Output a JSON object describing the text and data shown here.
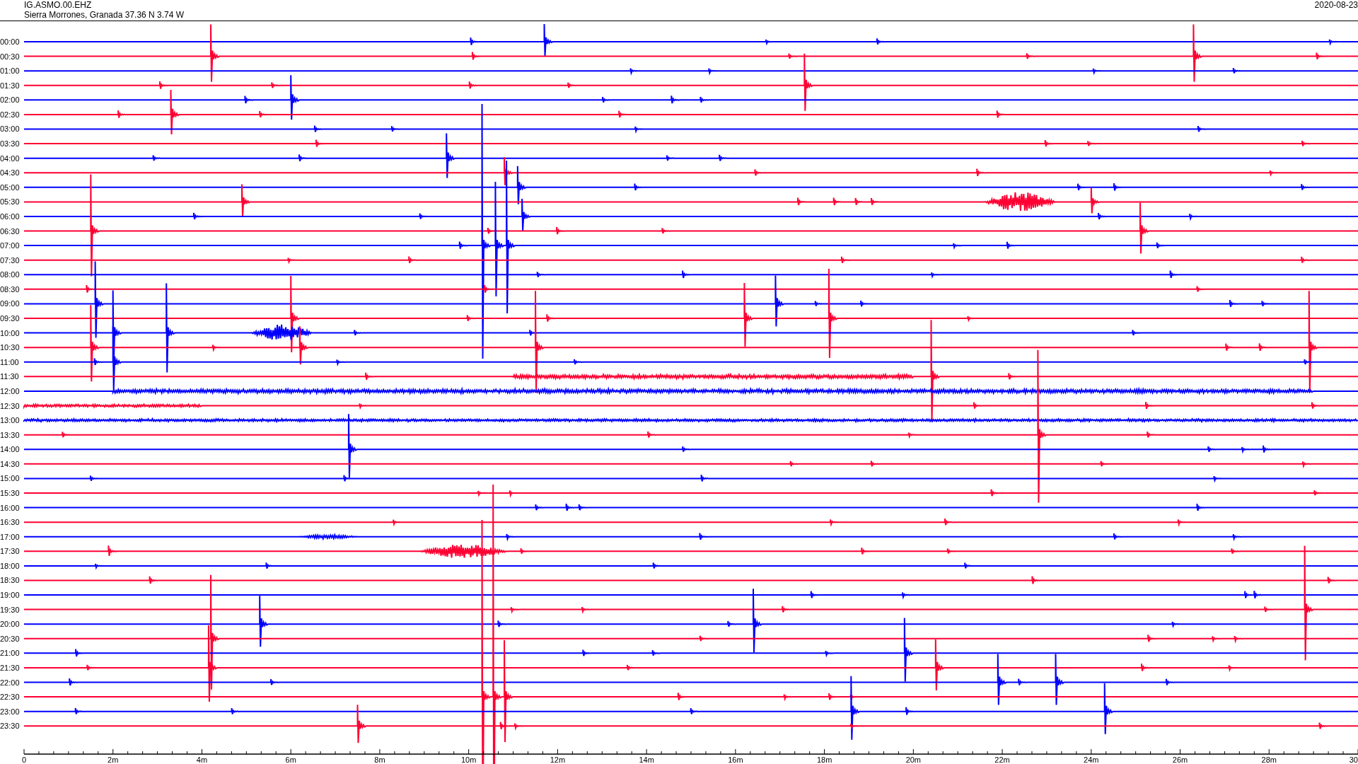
{
  "header": {
    "station": "IG.ASMO.00.EHZ",
    "location": "Sierra Morrones, Granada  37.36 N 3.74 W",
    "date": "2020-08-23"
  },
  "rows": [
    {
      "label": "00:00",
      "color": "#0000ff"
    },
    {
      "label": "00:30",
      "color": "#ff0033"
    },
    {
      "label": "01:00",
      "color": "#0000ff"
    },
    {
      "label": "01:30",
      "color": "#ff0033"
    },
    {
      "label": "02:00",
      "color": "#0000ff"
    },
    {
      "label": "02:30",
      "color": "#ff0033"
    },
    {
      "label": "03:00",
      "color": "#0000ff"
    },
    {
      "label": "03:30",
      "color": "#ff0033"
    },
    {
      "label": "04:00",
      "color": "#0000ff"
    },
    {
      "label": "04:30",
      "color": "#ff0033"
    },
    {
      "label": "05:00",
      "color": "#0000ff"
    },
    {
      "label": "05:30",
      "color": "#ff0033"
    },
    {
      "label": "06:00",
      "color": "#0000ff"
    },
    {
      "label": "06:30",
      "color": "#ff0033"
    },
    {
      "label": "07:00",
      "color": "#0000ff"
    },
    {
      "label": "07:30",
      "color": "#ff0033"
    },
    {
      "label": "08:00",
      "color": "#0000ff"
    },
    {
      "label": "08:30",
      "color": "#ff0033"
    },
    {
      "label": "09:00",
      "color": "#0000ff"
    },
    {
      "label": "09:30",
      "color": "#ff0033"
    },
    {
      "label": "10:00",
      "color": "#0000ff"
    },
    {
      "label": "10:30",
      "color": "#ff0033"
    },
    {
      "label": "11:00",
      "color": "#0000ff"
    },
    {
      "label": "11:30",
      "color": "#ff0033"
    },
    {
      "label": "12:00",
      "color": "#0000ff"
    },
    {
      "label": "12:30",
      "color": "#ff0033"
    },
    {
      "label": "13:00",
      "color": "#0000ff"
    },
    {
      "label": "13:30",
      "color": "#ff0033"
    },
    {
      "label": "14:00",
      "color": "#0000ff"
    },
    {
      "label": "14:30",
      "color": "#ff0033"
    },
    {
      "label": "15:00",
      "color": "#0000ff"
    },
    {
      "label": "15:30",
      "color": "#ff0033"
    },
    {
      "label": "16:00",
      "color": "#0000ff"
    },
    {
      "label": "16:30",
      "color": "#ff0033"
    },
    {
      "label": "17:00",
      "color": "#0000ff"
    },
    {
      "label": "17:30",
      "color": "#ff0033"
    },
    {
      "label": "18:00",
      "color": "#0000ff"
    },
    {
      "label": "18:30",
      "color": "#ff0033"
    },
    {
      "label": "19:00",
      "color": "#0000ff"
    },
    {
      "label": "19:30",
      "color": "#ff0033"
    },
    {
      "label": "20:00",
      "color": "#0000ff"
    },
    {
      "label": "20:30",
      "color": "#ff0033"
    },
    {
      "label": "21:00",
      "color": "#0000ff"
    },
    {
      "label": "21:30",
      "color": "#ff0033"
    },
    {
      "label": "22:00",
      "color": "#0000ff"
    },
    {
      "label": "22:30",
      "color": "#ff0033"
    },
    {
      "label": "23:00",
      "color": "#0000ff"
    },
    {
      "label": "23:30",
      "color": "#ff0033"
    }
  ],
  "x_axis": {
    "labels": [
      "0",
      "2m",
      "4m",
      "6m",
      "8m",
      "10m",
      "12m",
      "14m",
      "16m",
      "18m",
      "20m",
      "22m",
      "24m",
      "26m",
      "28m",
      "30"
    ]
  }
}
